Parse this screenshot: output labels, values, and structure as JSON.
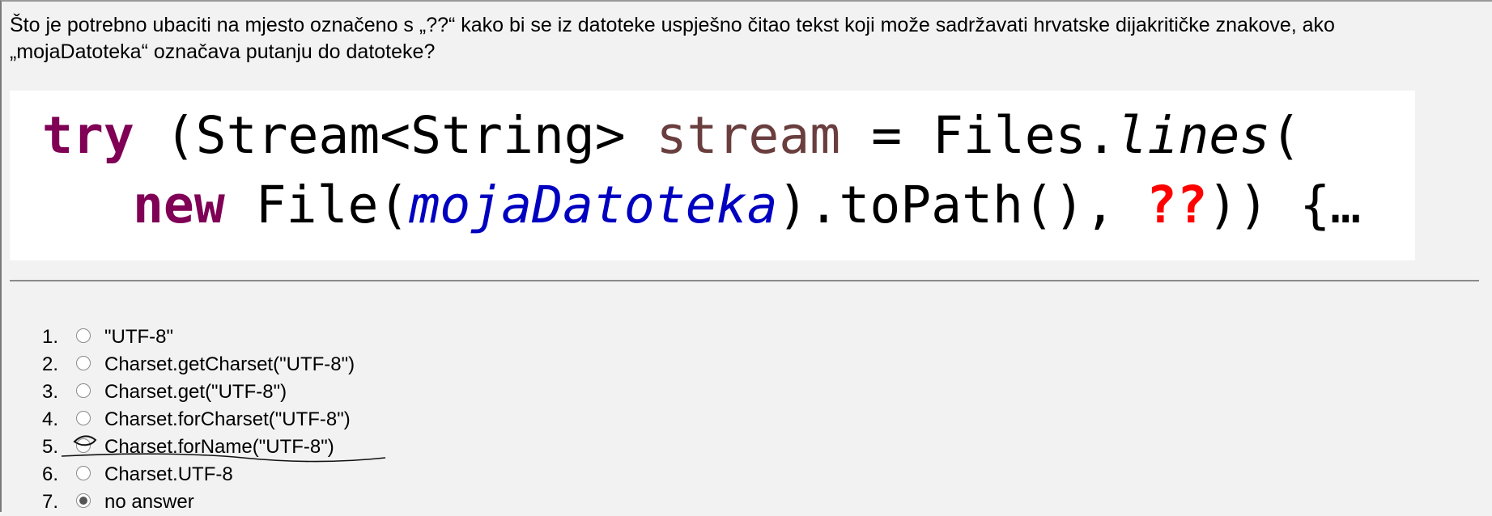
{
  "question": {
    "text": "Što je potrebno ubaciti na mjesto označeno s „??“ kako bi se iz datoteke uspješno čitao tekst koji može sadržavati hrvatske dijakritičke znakove, ako „mojaDatoteka“ označava putanju do datoteke?"
  },
  "code": {
    "line1": {
      "kw": "try",
      "p1": " (Stream<String> ",
      "var": "stream",
      "p2": " = Files.",
      "method": "lines",
      "p3": "("
    },
    "line2": {
      "kw": "new",
      "p1": " File(",
      "arg": "mojaDatoteka",
      "p2": ").toPath(), ",
      "placeholder": "??",
      "p3": ")) {…"
    }
  },
  "answers": [
    {
      "num": "1.",
      "label": "\"UTF-8\"",
      "selected": false
    },
    {
      "num": "2.",
      "label": "Charset.getCharset(\"UTF-8\")",
      "selected": false
    },
    {
      "num": "3.",
      "label": "Charset.get(\"UTF-8\")",
      "selected": false
    },
    {
      "num": "4.",
      "label": "Charset.forCharset(\"UTF-8\")",
      "selected": false
    },
    {
      "num": "5.",
      "label": "Charset.forName(\"UTF-8\")",
      "selected": false
    },
    {
      "num": "6.",
      "label": "Charset.UTF-8",
      "selected": false
    },
    {
      "num": "7.",
      "label": "no answer",
      "selected": true
    }
  ],
  "colors": {
    "keyword": "#7f0055",
    "variable": "#6a3e3e",
    "argument": "#0000c0",
    "placeholder": "#ff0000"
  }
}
